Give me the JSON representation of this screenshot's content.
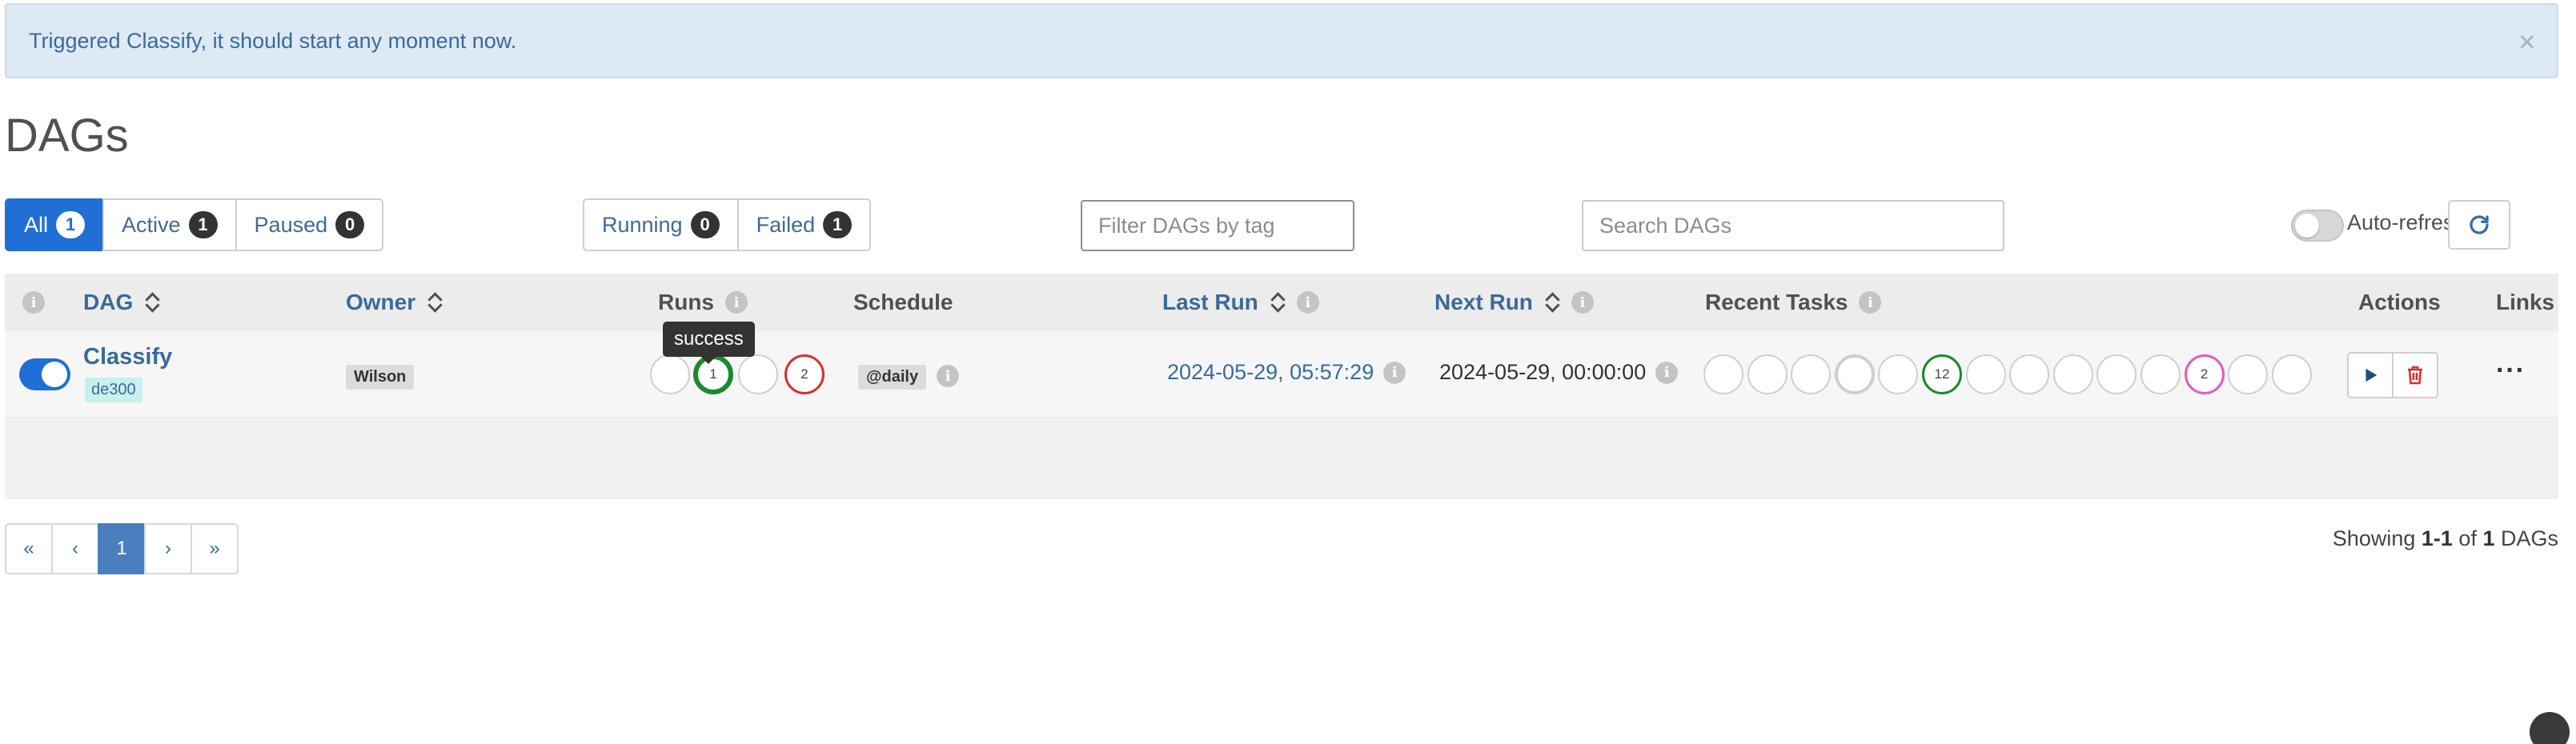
{
  "alert": {
    "message": "Triggered Classify, it should start any moment now.",
    "close": "×"
  },
  "page_title": "DAGs",
  "status_filter": [
    {
      "label": "All",
      "count": "1",
      "active": true
    },
    {
      "label": "Active",
      "count": "1",
      "active": false
    },
    {
      "label": "Paused",
      "count": "0",
      "active": false
    }
  ],
  "run_filter": [
    {
      "label": "Running",
      "count": "0"
    },
    {
      "label": "Failed",
      "count": "1"
    }
  ],
  "tag_filter": {
    "placeholder": "Filter DAGs by tag"
  },
  "search": {
    "placeholder": "Search DAGs"
  },
  "auto_refresh": {
    "label": "Auto-refresh",
    "enabled": false
  },
  "table": {
    "headers": {
      "dag": "DAG",
      "owner": "Owner",
      "runs": "Runs",
      "schedule": "Schedule",
      "last_run": "Last Run",
      "next_run": "Next Run",
      "recent_tasks": "Recent Tasks",
      "actions": "Actions",
      "links": "Links"
    },
    "rows": [
      {
        "name": "Classify",
        "tag": "de300",
        "owner": "Wilson",
        "runs": [
          "",
          "1",
          "",
          "2"
        ],
        "runs_tooltip": "success",
        "schedule": "@daily",
        "last_run": "2024-05-29, 05:57:29",
        "next_run": "2024-05-29, 00:00:00",
        "recent_tasks": [
          "",
          "",
          "",
          "",
          "",
          "12",
          "",
          "",
          "",
          "",
          "",
          "2",
          "",
          ""
        ],
        "links": "···"
      }
    ]
  },
  "pagination": {
    "first": "«",
    "prev": "‹",
    "current": "1",
    "next": "›",
    "last": "»"
  },
  "showing": {
    "prefix": "Showing ",
    "range": "1-1",
    "of": " of ",
    "total": "1",
    "suffix": " DAGs"
  },
  "colors": {
    "primary": "#1f6fd6",
    "success": "#1b8a2b",
    "failed": "#d9302b",
    "upstream_failed": "#e35bb8",
    "link": "#3a6a9a"
  }
}
